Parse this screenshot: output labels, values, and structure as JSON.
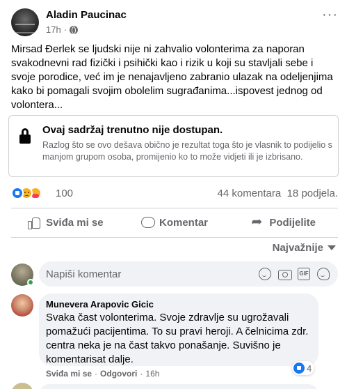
{
  "post": {
    "author": "Aladin Paucinac",
    "time": "17h",
    "time_sep": "·",
    "text": "Mirsad Đerlek se ljudski nije ni zahvalio volonterima za naporan svakodnevni rad fizički i psihički kao i rizik u koji su stavljali sebe i svoje porodice, već im je nenajavljeno zabranio ulazak na odeljenjima kako bi pomagali svojim obolelim sugrađanima...ispovest jednog od volontera..."
  },
  "unavailable": {
    "title": "Ovaj sadržaj trenutno nije dostupan.",
    "description": "Razlog što se ovo dešava obično je rezultat toga što je vlasnik to podijelio s manjom grupom osoba, promijenio ko to može vidjeti ili je izbrisano."
  },
  "stats": {
    "reactions": "100",
    "comments": "44 komentara",
    "shares": "18 podjela."
  },
  "actions": {
    "like": "Sviđa mi se",
    "comment": "Komentar",
    "share": "Podijelite"
  },
  "sort": {
    "label": "Najvažnije"
  },
  "comment_box": {
    "placeholder": "Napiši komentar",
    "gif_label": "GIF"
  },
  "comment": {
    "author": "Munevera Arapovic Gicic",
    "text": "Svaka čast volonterima. Svoje zdravlje su ugrožavali pomažući pacijentima. To su pravi heroji. A čelnicima zdr. centra neka je na čast takvo ponašanje. Suvišno je komentarisat dalje.",
    "like_label": "Sviđa mi se",
    "reply_label": "Odgovori",
    "time": "16h",
    "sep": "·",
    "reaction_count": "4"
  },
  "colors": {
    "text": "#050505",
    "secondary": "#65676b",
    "like_blue": "#1877f2",
    "bubble_bg": "#f0f2f5",
    "online_green": "#31a24c"
  }
}
